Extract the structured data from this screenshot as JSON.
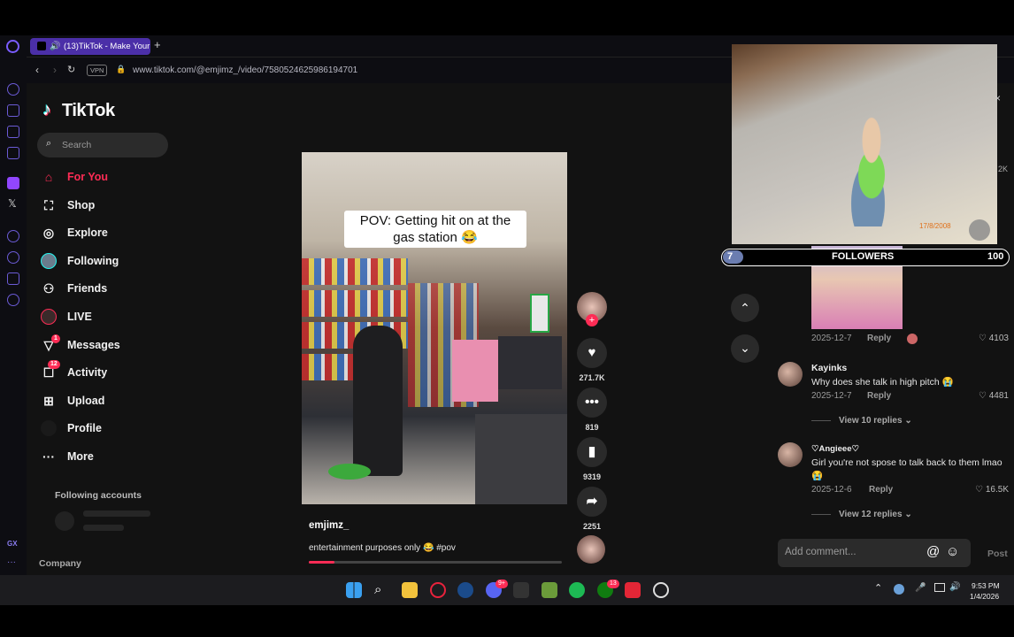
{
  "browser": {
    "tab_title": "(13)TikTok - Make Your",
    "tab_count_badge": "13",
    "vpn_label": "VPN",
    "url": "www.tiktok.com/@emjimz_/video/7580524625986194701"
  },
  "tiktok": {
    "logo_text": "TikTok",
    "search_placeholder": "Search",
    "nav": [
      {
        "label": "For You",
        "icon": "home-icon",
        "active": true
      },
      {
        "label": "Shop",
        "icon": "shop-bag-icon"
      },
      {
        "label": "Explore",
        "icon": "compass-icon"
      },
      {
        "label": "Following",
        "icon": "following-avatar-icon"
      },
      {
        "label": "Friends",
        "icon": "friends-icon"
      },
      {
        "label": "LIVE",
        "icon": "live-avatar-icon"
      },
      {
        "label": "Messages",
        "icon": "messages-icon",
        "badge": "1"
      },
      {
        "label": "Activity",
        "icon": "activity-icon",
        "badge": "12"
      },
      {
        "label": "Upload",
        "icon": "upload-icon"
      },
      {
        "label": "Profile",
        "icon": "profile-avatar-icon"
      },
      {
        "label": "More",
        "icon": "more-dots-icon"
      }
    ],
    "following_accounts_label": "Following accounts",
    "company_label": "Company",
    "video": {
      "overlay_caption": "POV: Getting hit on at the gas station 😂",
      "username": "emjimz_",
      "description": "entertainment purposes only 😂 #pov",
      "progress": 0.1
    },
    "actions": {
      "likes": "271.7K",
      "comments": "819",
      "saves": "9319",
      "shares": "2251"
    }
  },
  "comments": [
    {
      "name": "",
      "text": "",
      "date": "2025-12-7",
      "reply_label": "Reply",
      "likes": "4103"
    },
    {
      "name": "Kayinks",
      "text": "Why does she talk in high pitch 😭",
      "date": "2025-12-7",
      "reply_label": "Reply",
      "likes": "4481",
      "view_replies": "View 10 replies"
    },
    {
      "name": "♡Angieee♡",
      "text": "Girl you're not spose to talk back to them lmao 😭",
      "date": "2025-12-6",
      "reply_label": "Reply",
      "likes": "16.5K",
      "view_replies": "View 12 replies"
    }
  ],
  "comment_input": {
    "placeholder": "Add comment...",
    "post_label": "Post"
  },
  "overlay": {
    "photo_date": "17/8/2008",
    "followers_label": "FOLLOWERS",
    "followers_current": "7",
    "followers_goal": "100",
    "progress": 0.07,
    "side_count": "2K"
  },
  "taskbar": {
    "time": "9:53 PM",
    "date": "1/4/2026",
    "discord_badge": "9+",
    "xbox_badge": "13"
  },
  "colors": {
    "accent": "#fe2c55",
    "opera_tab": "#4b2fa8",
    "panel_bg": "#121212"
  }
}
